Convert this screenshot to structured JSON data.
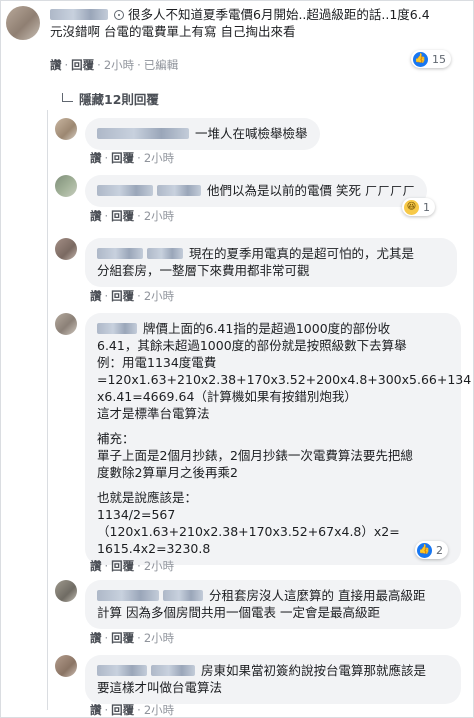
{
  "top_comment": {
    "text_lines": [
      "很多人不知道夏季電價6月開始..超過級距的話..1度6.4",
      "元沒錯啊 台電的電費單上有寫 自己掏出來看"
    ],
    "actions": {
      "like": "讚",
      "reply": "回覆",
      "time": "2小時",
      "edited": "已編輯"
    },
    "reaction_count": "15"
  },
  "hidden_replies": {
    "label": "隱藏12則回覆"
  },
  "replies": [
    {
      "text_lines": [
        "一堆人在喊檢舉檢舉"
      ],
      "actions": {
        "like": "讚",
        "reply": "回覆",
        "time": "2小時"
      }
    },
    {
      "text_lines": [
        "他們以為是以前的電價 笑死 ㄏㄏㄏㄏ"
      ],
      "actions": {
        "like": "讚",
        "reply": "回覆",
        "time": "2小時"
      },
      "reaction_count": "1"
    },
    {
      "text_lines": [
        "現在的夏季用電真的是超可怕的，尤其是",
        "分組套房，一整層下來費用都非常可觀"
      ],
      "actions": {
        "like": "讚",
        "reply": "回覆",
        "time": "2小時"
      }
    },
    {
      "paragraphs": [
        [
          "牌價上面的6.41指的是超過1000度的部份收",
          "6.41，其餘未超過1000度的部份就是按照級數下去算舉",
          "例：用電1134度電費",
          "=120x1.63+210x2.38+170x3.52+200x4.8+300x5.66+134",
          "x6.41=4669.64（計算機如果有按錯別炮我）",
          "這才是標準台電算法"
        ],
        [
          "補充：",
          "單子上面是2個月抄錶，2個月抄錶一次電費算法要先把總",
          "度數除2算單月之後再乘2"
        ],
        [
          "也就是說應該是：",
          "1134/2=567",
          "（120x1.63+210x2.38+170x3.52+67x4.8）x2=",
          "1615.4x2=3230.8"
        ]
      ],
      "actions": {
        "like": "讚",
        "reply": "回覆",
        "time": "2小時"
      },
      "reaction_count": "2"
    },
    {
      "text_lines": [
        "分租套房沒人這麼算的 直接用最高級距",
        "計算 因為多個房間共用一個電表 一定會是最高級距"
      ],
      "actions": {
        "like": "讚",
        "reply": "回覆",
        "time": "2小時"
      }
    },
    {
      "text_lines": [
        "房東如果當初簽約說按台電算那就應該是",
        "要這樣才叫做台電算法"
      ],
      "actions": {
        "like": "讚",
        "reply": "回覆",
        "time": "2小時"
      }
    }
  ]
}
